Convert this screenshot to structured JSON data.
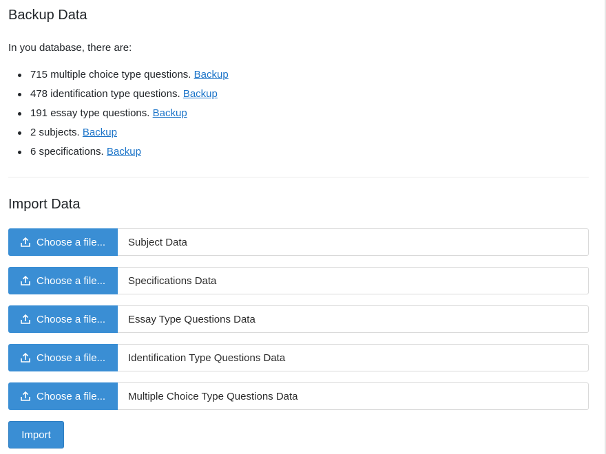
{
  "backup": {
    "title": "Backup Data",
    "intro": "In you database, there are:",
    "items": [
      {
        "text": "715 multiple choice type questions.",
        "link": "Backup"
      },
      {
        "text": "478 identification type questions.",
        "link": "Backup"
      },
      {
        "text": "191 essay type questions.",
        "link": "Backup"
      },
      {
        "text": "2 subjects.",
        "link": "Backup"
      },
      {
        "text": "6 specifications.",
        "link": "Backup"
      }
    ]
  },
  "import": {
    "title": "Import Data",
    "choose_label": "Choose a file...",
    "files": [
      {
        "name": "Subject Data"
      },
      {
        "name": "Specifications Data"
      },
      {
        "name": "Essay Type Questions Data"
      },
      {
        "name": "Identification Type Questions Data"
      },
      {
        "name": "Multiple Choice Type Questions Data"
      }
    ],
    "button_label": "Import"
  },
  "icons": {
    "upload": "upload-icon"
  },
  "colors": {
    "primary": "#3a8ed4",
    "link": "#1a73c8",
    "text": "#212529"
  }
}
